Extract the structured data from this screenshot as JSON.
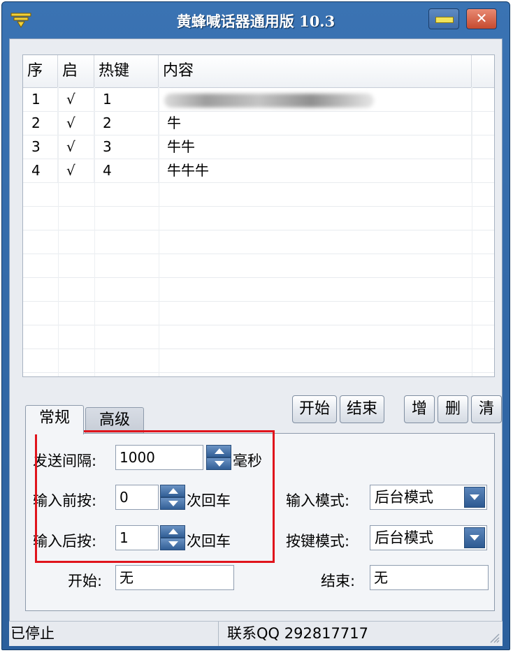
{
  "window": {
    "title": "黄蜂喊话器通用版 10.3",
    "close_glyph": "✕"
  },
  "table": {
    "columns": [
      "序",
      "启",
      "热键",
      "内容"
    ],
    "rows": [
      {
        "index": "1",
        "enabled": "√",
        "hotkey": "1",
        "content": ""
      },
      {
        "index": "2",
        "enabled": "√",
        "hotkey": "2",
        "content": "牛"
      },
      {
        "index": "3",
        "enabled": "√",
        "hotkey": "3",
        "content": "牛牛"
      },
      {
        "index": "4",
        "enabled": "√",
        "hotkey": "4",
        "content": "牛牛牛"
      }
    ]
  },
  "tabs": [
    "常规",
    "高级"
  ],
  "buttons": {
    "start": "开始",
    "stop": "结束",
    "add": "增",
    "delete": "删",
    "clear": "清"
  },
  "settings": {
    "send_interval_label": "发送间隔:",
    "send_interval_value": "1000",
    "send_interval_unit": "毫秒",
    "press_before_label": "输入前按:",
    "press_before_value": "0",
    "press_before_unit": "次回车",
    "press_after_label": "输入后按:",
    "press_after_value": "1",
    "press_after_unit": "次回车",
    "input_mode_label": "输入模式:",
    "input_mode_value": "后台模式",
    "key_mode_label": "按键模式:",
    "key_mode_value": "后台模式",
    "start_key_label": "开始:",
    "start_key_value": "无",
    "stop_key_label": "结束:",
    "stop_key_value": "无"
  },
  "status": {
    "state": "已停止",
    "contact": "联系QQ 292817717"
  },
  "colors": {
    "title_bar": "#2b5f9c",
    "highlight_box": "#e0141c"
  }
}
